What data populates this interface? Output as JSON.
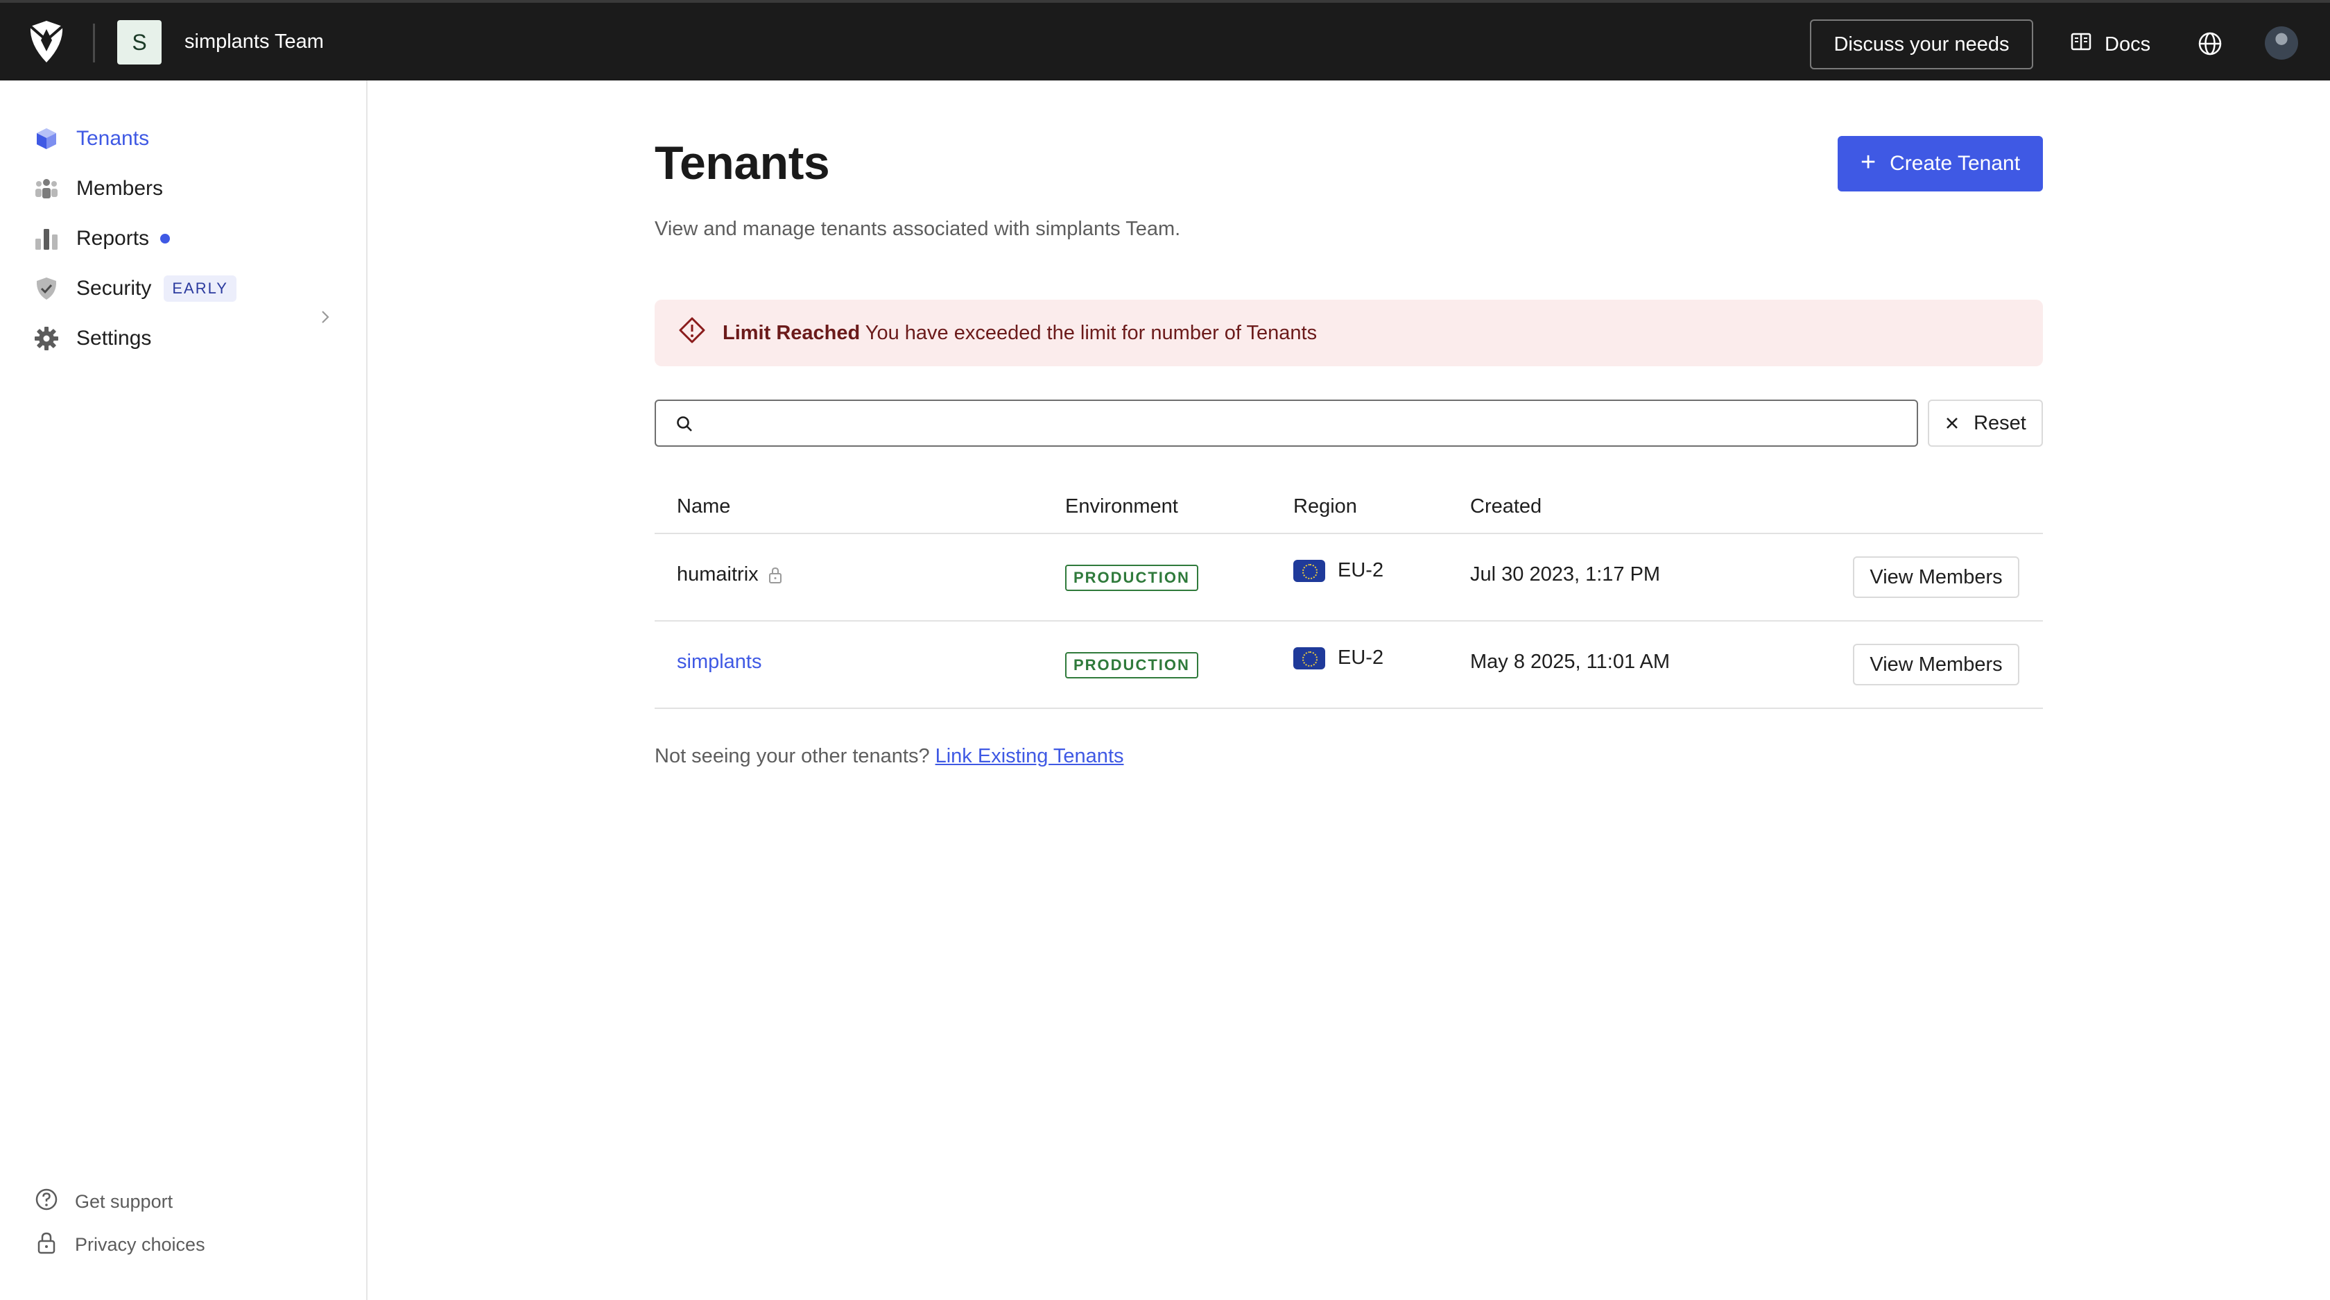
{
  "topbar": {
    "team_initial": "S",
    "team_name": "simplants Team",
    "discuss_label": "Discuss your needs",
    "docs_label": "Docs"
  },
  "sidebar": {
    "items": [
      {
        "label": "Tenants",
        "icon": "cube-icon",
        "active": true
      },
      {
        "label": "Members",
        "icon": "members-icon"
      },
      {
        "label": "Reports",
        "icon": "bar-chart-icon",
        "has_dot": true,
        "has_chevron": true
      },
      {
        "label": "Security",
        "icon": "shield-check-icon",
        "badge": "EARLY"
      },
      {
        "label": "Settings",
        "icon": "gear-icon"
      }
    ],
    "footer": [
      {
        "label": "Get support",
        "icon": "help-circle-icon"
      },
      {
        "label": "Privacy choices",
        "icon": "lock-icon"
      }
    ]
  },
  "main": {
    "title": "Tenants",
    "subtitle": "View and manage tenants associated with simplants Team.",
    "create_button": "Create Tenant",
    "alert": {
      "title": "Limit Reached",
      "message": "You have exceeded the limit for number of Tenants"
    },
    "search": {
      "value": "",
      "placeholder": ""
    },
    "reset_label": "Reset",
    "table": {
      "headers": [
        "Name",
        "Environment",
        "Region",
        "Created"
      ],
      "rows": [
        {
          "name": "humaitrix",
          "locked": true,
          "environment": "PRODUCTION",
          "region": "EU-2",
          "created": "Jul 30 2023, 1:17 PM",
          "action": "View Members"
        },
        {
          "name": "simplants",
          "locked": false,
          "environment": "PRODUCTION",
          "region": "EU-2",
          "created": "May 8 2025, 11:01 AM",
          "action": "View Members"
        }
      ]
    },
    "footer_note": "Not seeing your other tenants?",
    "footer_link": "Link Existing Tenants"
  },
  "colors": {
    "accent": "#3f59e4",
    "topbar_bg": "#1b1b1b",
    "alert_bg": "#fbecec",
    "production_green": "#2f7a3b"
  }
}
